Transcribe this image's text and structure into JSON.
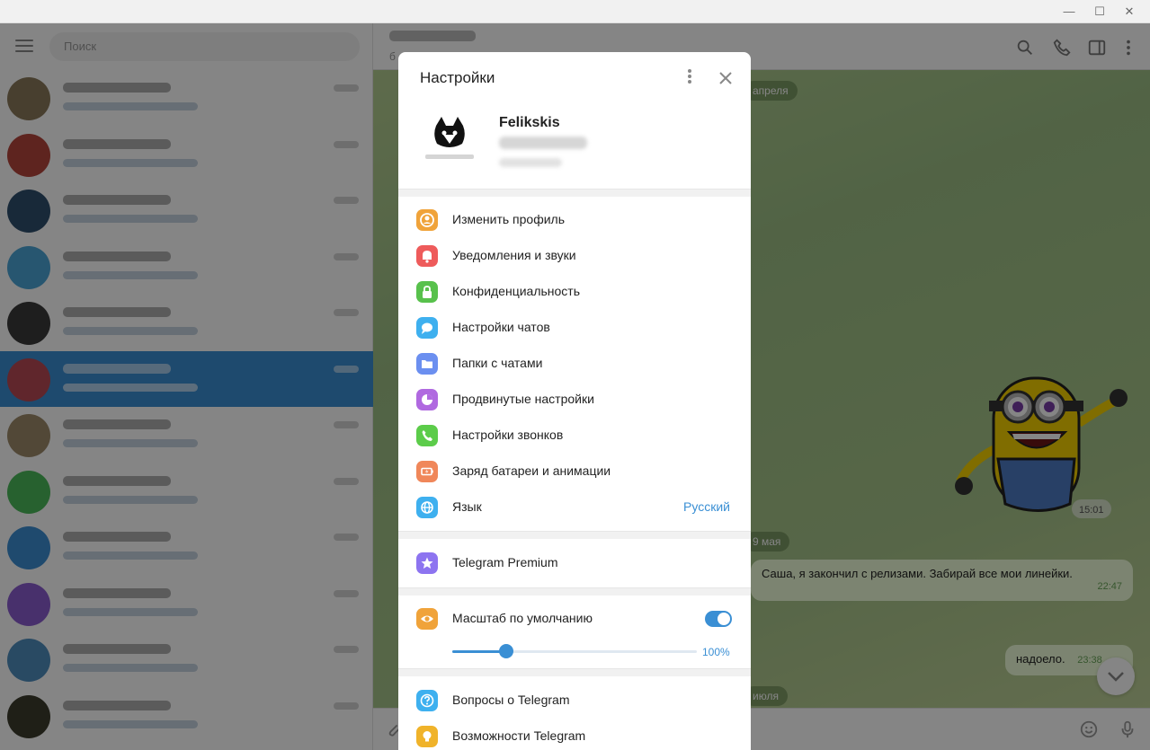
{
  "search": {
    "placeholder": "Поиск"
  },
  "chat": {
    "subtitle": "б",
    "date_pills": [
      "апреля",
      "9 мая",
      "июля"
    ],
    "messages": [
      {
        "text": "",
        "time": "15:01"
      },
      {
        "text": "Саша, я закончил с релизами. Забирай все мои линейки.",
        "time": "22:47"
      },
      {
        "text": "надоело.",
        "time": "23:38"
      }
    ]
  },
  "settings": {
    "title": "Настройки",
    "profile_name": "Felikskis",
    "items": [
      {
        "label": "Изменить профиль",
        "icon": "person-icon",
        "color": "#f0a33a"
      },
      {
        "label": "Уведомления и звуки",
        "icon": "bell-icon",
        "color": "#ee5b5b"
      },
      {
        "label": "Конфиденциальность",
        "icon": "lock-icon",
        "color": "#58c14c"
      },
      {
        "label": "Настройки чатов",
        "icon": "chat-bubble-icon",
        "color": "#3eb0ef"
      },
      {
        "label": "Папки с чатами",
        "icon": "folder-icon",
        "color": "#6b8ff0"
      },
      {
        "label": "Продвинутые настройки",
        "icon": "pie-chart-icon",
        "color": "#b069e0"
      },
      {
        "label": "Настройки звонков",
        "icon": "phone-icon",
        "color": "#5ccc4a"
      },
      {
        "label": "Заряд батареи и анимации",
        "icon": "battery-icon",
        "color": "#f0875a"
      },
      {
        "label": "Язык",
        "icon": "globe-icon",
        "color": "#3eb0ef",
        "value": "Русский"
      }
    ],
    "premium": {
      "label": "Telegram Premium",
      "icon": "star-icon",
      "color": "#8d74f0"
    },
    "scale": {
      "label": "Масштаб по умолчанию",
      "icon": "eye-icon",
      "color": "#f0a33a",
      "enabled": true,
      "value_text": "100%",
      "fraction": 0.22
    },
    "help": [
      {
        "label": "Вопросы о Telegram",
        "icon": "question-icon",
        "color": "#3eb0ef"
      },
      {
        "label": "Возможности Telegram",
        "icon": "lightbulb-icon",
        "color": "#f0b32a"
      }
    ]
  }
}
